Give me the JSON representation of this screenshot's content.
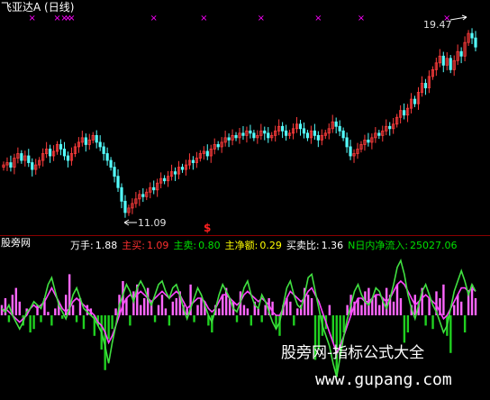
{
  "chart_title": "飞亚达A (日线)",
  "price_chart": {
    "high_annotation": "19.47",
    "low_annotation": "11.09",
    "signal_mark": "$",
    "marker_glyph": "×"
  },
  "indicator_bar": {
    "left_label": "股旁网",
    "items": [
      {
        "label": "万手:",
        "value": "1.88",
        "color": "#ffffff"
      },
      {
        "label": "主买:",
        "value": "1.09",
        "color": "#ff3030"
      },
      {
        "label": "主卖:",
        "value": "0.80",
        "color": "#00e000"
      },
      {
        "label": "主净额:",
        "value": "0.29",
        "color": "#ffff00"
      },
      {
        "label": "买卖比:",
        "value": "1.36",
        "color": "#ffffff"
      },
      {
        "label": "N日内净流入:",
        "value": "25027.06",
        "color": "#00e000"
      }
    ]
  },
  "watermark": {
    "line1": "股旁网-指标公式大全",
    "line2": "www.gupang.com"
  },
  "colors": {
    "up_candle": "#ff3c3c",
    "down_candle": "#54ffff",
    "marker": "#ff00ff",
    "line_green": "#40e040",
    "line_magenta": "#ff44ff",
    "bar_magenta": "#ff66ff",
    "bar_green": "#20d020"
  },
  "chart_data": [
    {
      "type": "candlestick",
      "title": "飞亚达A (日线)",
      "y_annotations": {
        "high": 19.47,
        "low": 11.09
      },
      "closes": [
        13.4,
        13.5,
        13.3,
        13.7,
        13.9,
        13.6,
        13.8,
        13.5,
        13.2,
        13.4,
        13.6,
        13.9,
        14.1,
        13.8,
        14.0,
        14.3,
        14.1,
        13.8,
        13.6,
        13.9,
        14.2,
        14.4,
        14.6,
        14.3,
        14.5,
        14.7,
        14.4,
        14.2,
        13.9,
        13.6,
        13.3,
        12.9,
        12.4,
        11.8,
        11.3,
        11.5,
        11.7,
        11.9,
        12.1,
        12.0,
        12.2,
        12.4,
        12.3,
        12.6,
        12.8,
        12.7,
        12.9,
        13.1,
        13.0,
        13.3,
        13.2,
        13.4,
        13.6,
        13.5,
        13.7,
        13.9,
        14.0,
        13.8,
        14.1,
        14.3,
        14.2,
        14.4,
        14.6,
        14.5,
        14.7,
        14.6,
        14.8,
        14.7,
        14.9,
        14.8,
        14.6,
        14.7,
        14.9,
        14.8,
        14.6,
        14.7,
        14.9,
        15.1,
        14.9,
        14.7,
        14.8,
        15.0,
        15.2,
        15.0,
        14.8,
        14.6,
        14.9,
        14.7,
        14.5,
        14.7,
        14.8,
        15.0,
        15.3,
        15.1,
        14.9,
        14.6,
        14.2,
        13.8,
        13.9,
        14.1,
        14.3,
        14.5,
        14.4,
        14.6,
        14.8,
        14.7,
        14.9,
        15.1,
        15.0,
        15.2,
        15.5,
        15.8,
        15.6,
        15.9,
        16.3,
        16.1,
        16.6,
        17.0,
        16.8,
        17.3,
        17.6,
        17.9,
        18.2,
        17.8,
        18.1,
        17.6,
        18.0,
        18.4,
        18.2,
        18.8,
        19.2,
        19.0,
        18.6
      ],
      "indicator": {
        "title": "股旁网",
        "series": [
          {
            "name": "万手",
            "value": 1.88
          },
          {
            "name": "主买",
            "value": 1.09
          },
          {
            "name": "主卖",
            "value": 0.8
          },
          {
            "name": "主净额",
            "value": 0.29
          },
          {
            "name": "买卖比",
            "value": 1.36
          },
          {
            "name": "N日内净流入",
            "value": 25027.06
          }
        ],
        "bars": [
          0.3,
          0.5,
          -0.2,
          0.6,
          0.8,
          0.4,
          -0.3,
          0.2,
          -0.5,
          -0.4,
          0.3,
          -0.2,
          0.5,
          0.1,
          -0.3,
          0.2,
          0.4,
          -0.1,
          0.6,
          1.2,
          0.3,
          -0.2,
          0.5,
          -0.4,
          0.3,
          0.2,
          -0.6,
          -0.3,
          -1.0,
          -1.6,
          -0.7,
          -0.4,
          0.2,
          0.6,
          1.0,
          0.5,
          -0.3,
          0.7,
          0.9,
          0.3,
          0.5,
          0.8,
          0.4,
          -0.2,
          0.3,
          0.6,
          0.2,
          -0.3,
          0.4,
          0.5,
          0.7,
          0.3,
          0.2,
          0.9,
          -0.2,
          0.3,
          0.5,
          0.4,
          -0.3,
          -0.5,
          0.3,
          0.2,
          0.6,
          0.8,
          0.5,
          0.4,
          -0.2,
          0.7,
          0.3,
          0.2,
          -0.3,
          0.4,
          0.2,
          -0.2,
          0.3,
          0.5,
          0.4,
          -0.4,
          -0.6,
          0.3,
          0.5,
          0.4,
          -0.3,
          0.2,
          0.3,
          0.8,
          0.6,
          0.5,
          -1.3,
          -1.0,
          -0.6,
          -0.4,
          0.3,
          -0.8,
          -1.8,
          -1.2,
          -0.5,
          0.3,
          0.6,
          0.4,
          0.5,
          0.3,
          0.7,
          0.8,
          0.5,
          0.6,
          0.3,
          0.5,
          0.8,
          0.6,
          0.4,
          0.9,
          0.5,
          -0.8,
          -0.5,
          0.3,
          0.6,
          0.4,
          0.8,
          -0.3,
          0.5,
          -0.4,
          0.7,
          0.5,
          0.9,
          -0.6,
          -1.1,
          0.3,
          0.6,
          0.4,
          -0.5,
          0.7,
          0.9,
          0.5
        ],
        "line_a": [
          0.2,
          0.1,
          0.3,
          0.0,
          -0.2,
          -0.4,
          -0.2,
          0.1,
          0.2,
          0.4,
          0.3,
          0.2,
          0.5,
          0.9,
          1.1,
          0.7,
          0.3,
          0.1,
          -0.1,
          0.2,
          0.6,
          0.8,
          0.5,
          0.2,
          0.1,
          0.0,
          -0.1,
          -0.3,
          -0.5,
          -0.9,
          -1.4,
          -0.8,
          -0.3,
          0.3,
          0.6,
          0.9,
          0.7,
          0.4,
          0.8,
          1.0,
          0.8,
          0.5,
          0.3,
          0.6,
          0.9,
          1.0,
          0.7,
          0.5,
          0.8,
          0.9,
          0.6,
          0.2,
          -0.1,
          0.2,
          0.5,
          0.8,
          0.6,
          0.3,
          0.0,
          -0.2,
          0.2,
          0.6,
          0.9,
          0.7,
          0.5,
          0.2,
          0.1,
          0.4,
          0.8,
          1.0,
          0.6,
          0.3,
          0.2,
          0.6,
          0.4,
          0.1,
          -0.2,
          -0.4,
          -0.2,
          0.3,
          0.8,
          1.0,
          0.6,
          0.3,
          0.2,
          0.6,
          1.1,
          1.2,
          0.7,
          0.2,
          -0.3,
          -0.6,
          -0.9,
          -1.4,
          -1.8,
          -1.2,
          -0.6,
          -0.1,
          0.3,
          0.7,
          0.9,
          0.6,
          0.4,
          0.3,
          0.5,
          0.8,
          0.7,
          0.4,
          0.2,
          0.5,
          0.9,
          1.4,
          1.6,
          1.2,
          0.6,
          0.2,
          -0.1,
          0.3,
          0.7,
          0.9,
          0.6,
          0.3,
          0.1,
          -0.2,
          -0.5,
          -0.3,
          0.2,
          0.7,
          1.0,
          1.3,
          1.0,
          0.6,
          0.9,
          0.7
        ],
        "line_b": [
          0.1,
          0.2,
          0.1,
          0.0,
          -0.1,
          -0.2,
          -0.1,
          0.0,
          0.2,
          0.3,
          0.2,
          0.3,
          0.4,
          0.6,
          0.8,
          0.6,
          0.4,
          0.2,
          0.1,
          0.2,
          0.4,
          0.5,
          0.4,
          0.3,
          0.2,
          0.1,
          0.0,
          -0.2,
          -0.3,
          -0.5,
          -0.8,
          -0.6,
          -0.3,
          0.0,
          0.3,
          0.5,
          0.6,
          0.5,
          0.6,
          0.7,
          0.6,
          0.5,
          0.4,
          0.5,
          0.6,
          0.7,
          0.6,
          0.5,
          0.6,
          0.7,
          0.6,
          0.4,
          0.2,
          0.3,
          0.4,
          0.5,
          0.5,
          0.4,
          0.2,
          0.1,
          0.2,
          0.4,
          0.6,
          0.6,
          0.5,
          0.4,
          0.3,
          0.4,
          0.6,
          0.7,
          0.6,
          0.5,
          0.4,
          0.5,
          0.4,
          0.3,
          0.1,
          0.0,
          0.0,
          0.2,
          0.5,
          0.7,
          0.6,
          0.5,
          0.4,
          0.5,
          0.7,
          0.8,
          0.6,
          0.4,
          0.1,
          -0.2,
          -0.5,
          -0.8,
          -1.1,
          -0.9,
          -0.6,
          -0.3,
          0.0,
          0.3,
          0.5,
          0.5,
          0.4,
          0.4,
          0.5,
          0.6,
          0.6,
          0.5,
          0.4,
          0.5,
          0.7,
          0.9,
          1.0,
          0.9,
          0.7,
          0.5,
          0.3,
          0.4,
          0.5,
          0.6,
          0.5,
          0.4,
          0.3,
          0.1,
          -0.1,
          0.0,
          0.2,
          0.4,
          0.6,
          0.8,
          0.8,
          0.7,
          0.8,
          0.7
        ]
      }
    }
  ]
}
